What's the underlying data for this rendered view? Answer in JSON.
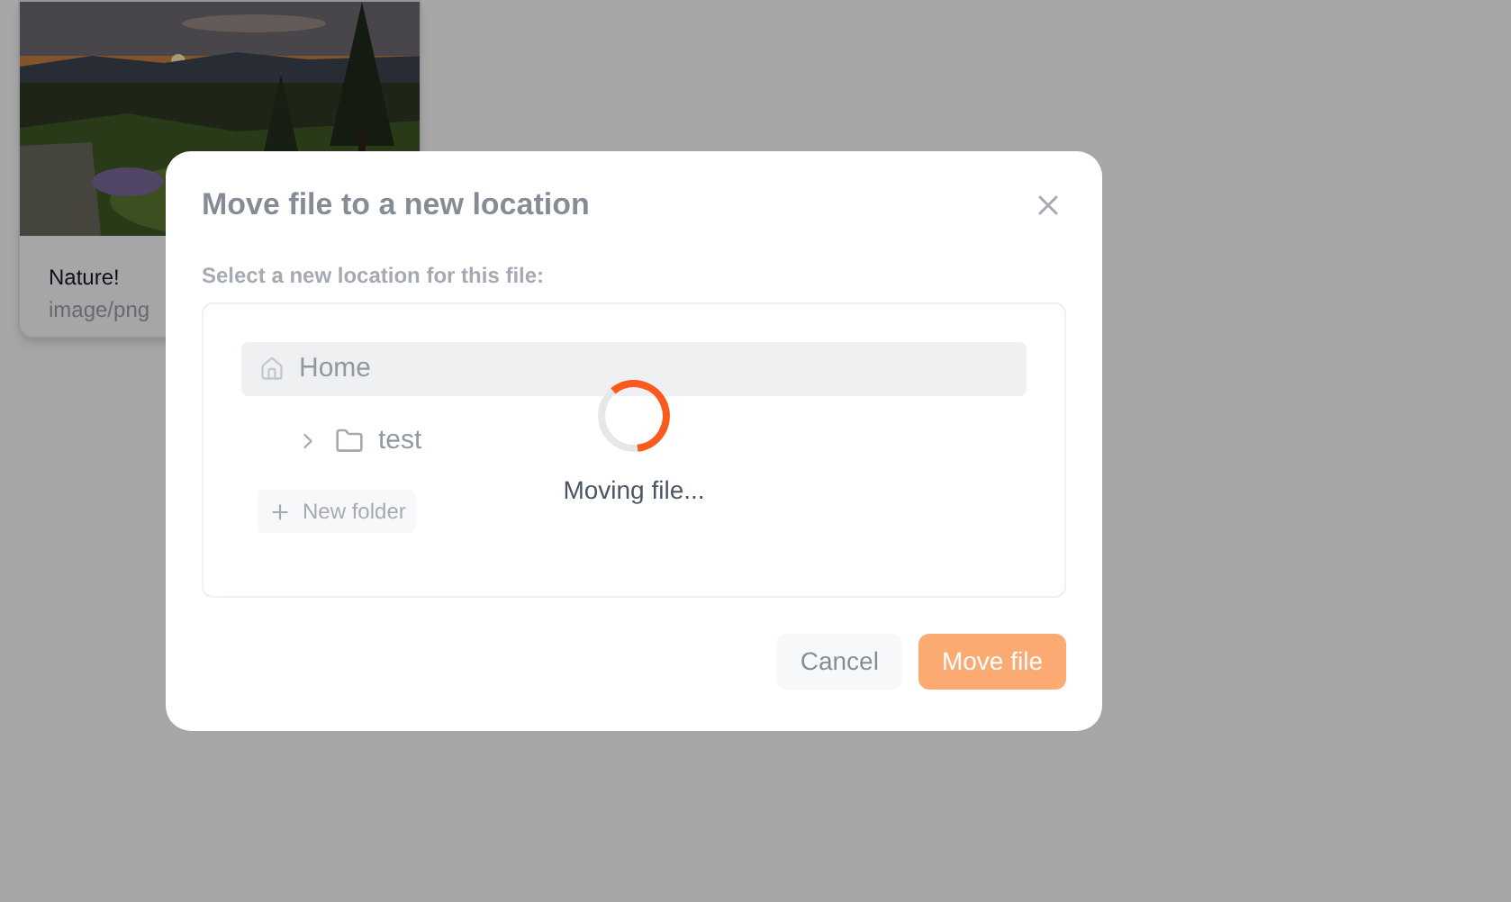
{
  "file_card": {
    "kind": "picture",
    "name": "Nature!",
    "type": "image/png"
  },
  "dialog": {
    "title": "Move file to a new location",
    "label": "Select a new location for this file:",
    "disabled": true,
    "tree": [
      {
        "label": "Home",
        "selected": true,
        "children": [
          {
            "label": "test",
            "selected": false,
            "expanded": false
          }
        ]
      }
    ],
    "new_folder": "New folder",
    "loading": {
      "text": "Moving file..."
    },
    "buttons": [
      {
        "label": "Cancel",
        "kind": "secondary"
      },
      {
        "label": "Move file",
        "kind": "primary"
      }
    ]
  }
}
